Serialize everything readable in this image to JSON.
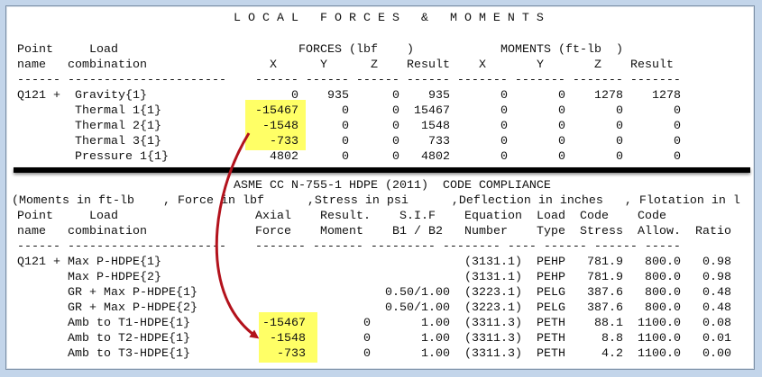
{
  "top": {
    "title": "L O C A L   F O R C E S   &   M O M E N T S",
    "header1": {
      "point": "Point",
      "load": "Load",
      "forces": "FORCES (lbf    )",
      "moments": "MOMENTS (ft-lb  )"
    },
    "header2": [
      "name",
      "combination",
      "X",
      "Y",
      "Z",
      "Result",
      "X",
      "Y",
      "Z",
      "Result"
    ],
    "dashes": "------ ----------------------    ------ ------ ------ ------ ------- ------- ------- -------",
    "rows": [
      {
        "point": "Q121 +",
        "load": "Gravity{1}",
        "values": [
          "0",
          "935",
          "0",
          "935",
          "0",
          "0",
          "1278",
          "1278"
        ]
      },
      {
        "point": "",
        "load": "Thermal 1{1}",
        "values": [
          "-15467",
          "0",
          "0",
          "15467",
          "0",
          "0",
          "0",
          "0"
        ]
      },
      {
        "point": "",
        "load": "Thermal 2{1}",
        "values": [
          "-1548",
          "0",
          "0",
          "1548",
          "0",
          "0",
          "0",
          "0"
        ]
      },
      {
        "point": "",
        "load": "Thermal 3{1}",
        "values": [
          "-733",
          "0",
          "0",
          "733",
          "0",
          "0",
          "0",
          "0"
        ]
      },
      {
        "point": "",
        "load": "Pressure 1{1}",
        "values": [
          "4802",
          "0",
          "0",
          "4802",
          "0",
          "0",
          "0",
          "0"
        ]
      }
    ]
  },
  "bottom": {
    "title": "ASME CC N-755-1 HDPE (2011)  CODE COMPLIANCE",
    "units": "(Moments in ft-lb    , Force in lbf      ,Stress in psi      ,Deflection in inches   , Flotation in l",
    "header1": [
      "Point",
      "Load",
      "Axial",
      "Result.",
      "S.I.F",
      "Equation",
      "Load",
      "Code",
      "Code"
    ],
    "header2": [
      "name",
      "combination",
      "Force",
      "Moment",
      "B1 / B2",
      "Number",
      "Type",
      "Stress",
      "Allow.",
      "Ratio"
    ],
    "dashes": "------ ----------------------    ------- ------- --------- -------- ---- ------ ------ -----",
    "rows": [
      {
        "point": "Q121 +",
        "load": "Max P-HDPE{1}",
        "axial": "",
        "moment": "",
        "sif": "",
        "equation": "(3131.1)",
        "type": "PEHP",
        "stress": "781.9",
        "allow": "800.0",
        "ratio": "0.98"
      },
      {
        "point": "",
        "load": "Max P-HDPE{2}",
        "axial": "",
        "moment": "",
        "sif": "",
        "equation": "(3131.1)",
        "type": "PEHP",
        "stress": "781.9",
        "allow": "800.0",
        "ratio": "0.98"
      },
      {
        "point": "",
        "load": "GR + Max P-HDPE{1}",
        "axial": "",
        "moment": "",
        "sif": "0.50/1.00",
        "equation": "(3223.1)",
        "type": "PELG",
        "stress": "387.6",
        "allow": "800.0",
        "ratio": "0.48"
      },
      {
        "point": "",
        "load": "GR + Max P-HDPE{2}",
        "axial": "",
        "moment": "",
        "sif": "0.50/1.00",
        "equation": "(3223.1)",
        "type": "PELG",
        "stress": "387.6",
        "allow": "800.0",
        "ratio": "0.48"
      },
      {
        "point": "",
        "load": "Amb to T1-HDPE{1}",
        "axial": "-15467",
        "moment": "0",
        "sif": "1.00",
        "equation": "(3311.3)",
        "type": "PETH",
        "stress": "88.1",
        "allow": "1100.0",
        "ratio": "0.08"
      },
      {
        "point": "",
        "load": "Amb to T2-HDPE{1}",
        "axial": "-1548",
        "moment": "0",
        "sif": "1.00",
        "equation": "(3311.3)",
        "type": "PETH",
        "stress": "8.8",
        "allow": "1100.0",
        "ratio": "0.01"
      },
      {
        "point": "",
        "load": "Amb to T3-HDPE{1}",
        "axial": "-733",
        "moment": "0",
        "sif": "1.00",
        "equation": "(3311.3)",
        "type": "PETH",
        "stress": "4.2",
        "allow": "1100.0",
        "ratio": "0.00"
      }
    ]
  },
  "colors": {
    "highlight": "#ffff66",
    "arrow": "#b3121c"
  }
}
